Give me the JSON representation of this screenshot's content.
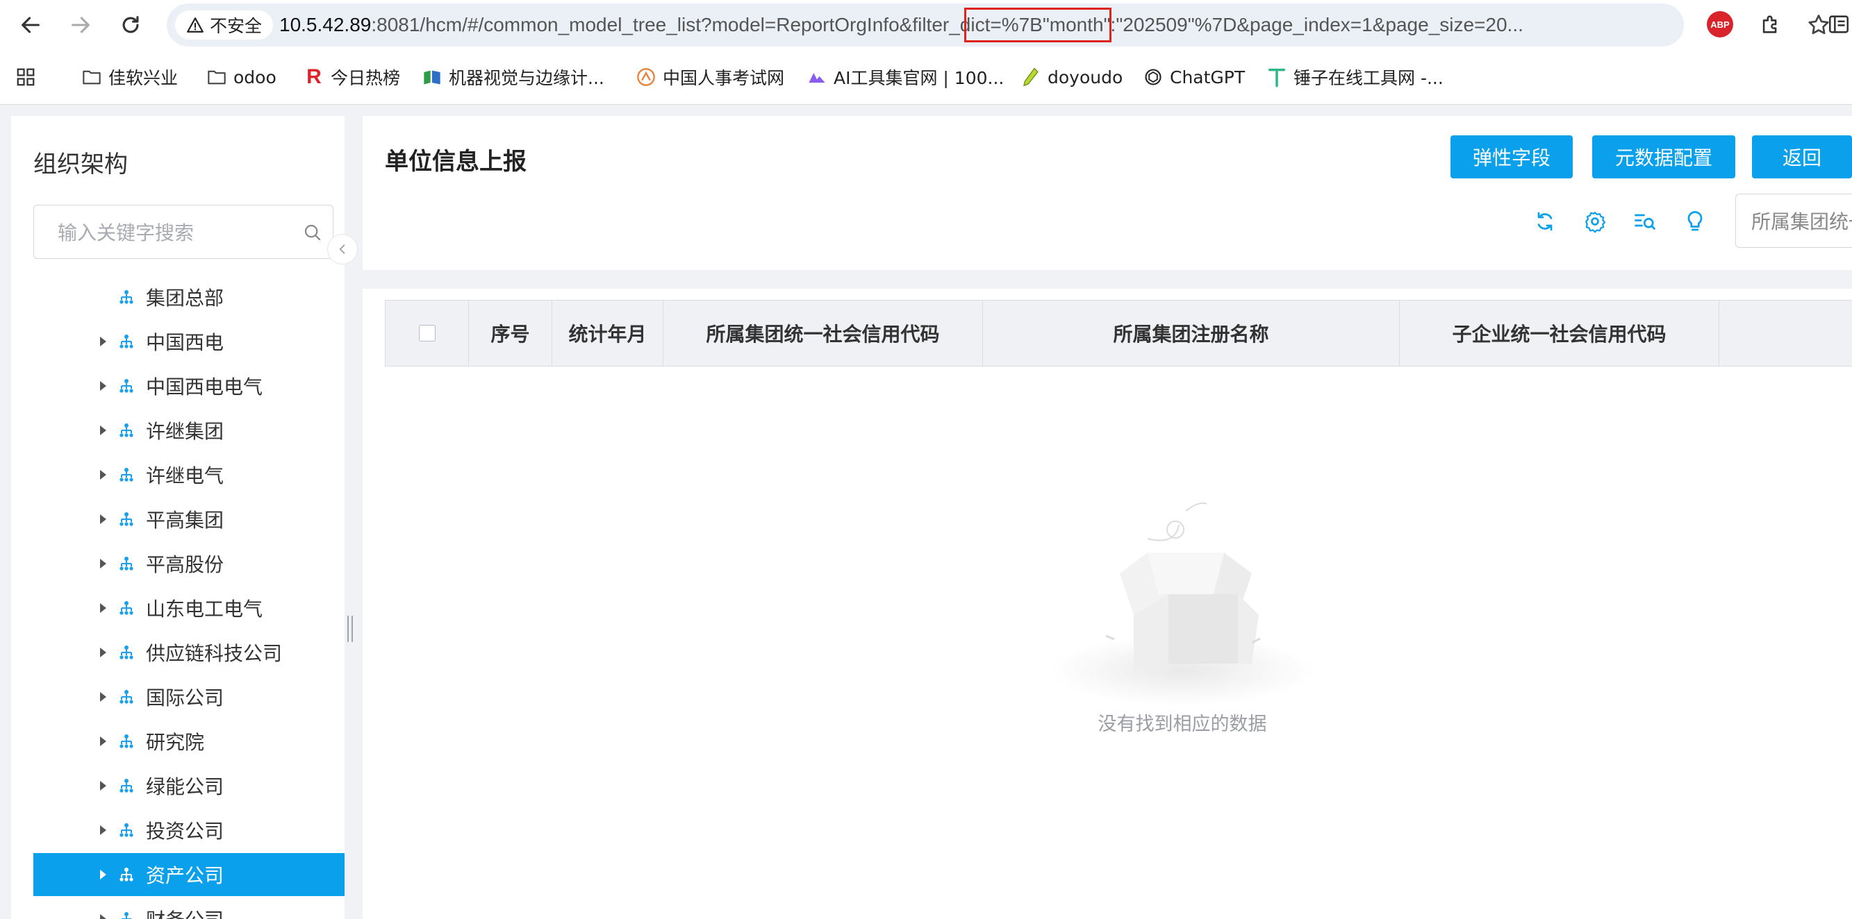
{
  "browser": {
    "security_label": "不安全",
    "url_host": "10.5.42.89",
    "url_rest": ":8081/hcm/#/common_model_tree_list?model=ReportOrgInfo&filter_dict=%7B\"month\":\"202509\"%7D&page_index=1&page_size=20...",
    "extension_badge": "ABP",
    "bookmarks": [
      {
        "label": "佳软兴业",
        "icon": "folder-icon"
      },
      {
        "label": "odoo",
        "icon": "folder-icon"
      },
      {
        "label": "今日热榜",
        "icon": "r-logo-icon"
      },
      {
        "label": "机器视觉与边缘计...",
        "icon": "book-icon"
      },
      {
        "label": "中国人事考试网",
        "icon": "exam-logo-icon"
      },
      {
        "label": "AI工具集官网 | 100...",
        "icon": "ai-logo-icon"
      },
      {
        "label": "doyoudo",
        "icon": "pencil-logo-icon"
      },
      {
        "label": "ChatGPT",
        "icon": "chatgpt-icon"
      },
      {
        "label": "锤子在线工具网 -...",
        "icon": "hammer-logo-icon"
      }
    ]
  },
  "sidebar": {
    "title": "组织架构",
    "search_placeholder": "输入关键字搜索",
    "nodes": [
      {
        "label": "集团总部",
        "has_children": false,
        "active": false
      },
      {
        "label": "中国西电",
        "has_children": true,
        "active": false
      },
      {
        "label": "中国西电电气",
        "has_children": true,
        "active": false
      },
      {
        "label": "许继集团",
        "has_children": true,
        "active": false
      },
      {
        "label": "许继电气",
        "has_children": true,
        "active": false
      },
      {
        "label": "平高集团",
        "has_children": true,
        "active": false
      },
      {
        "label": "平高股份",
        "has_children": true,
        "active": false
      },
      {
        "label": "山东电工电气",
        "has_children": true,
        "active": false
      },
      {
        "label": "供应链科技公司",
        "has_children": true,
        "active": false
      },
      {
        "label": "国际公司",
        "has_children": true,
        "active": false
      },
      {
        "label": "研究院",
        "has_children": true,
        "active": false
      },
      {
        "label": "绿能公司",
        "has_children": true,
        "active": false
      },
      {
        "label": "投资公司",
        "has_children": true,
        "active": false
      },
      {
        "label": "资产公司",
        "has_children": true,
        "active": true
      },
      {
        "label": "财务公司",
        "has_children": true,
        "active": false
      }
    ]
  },
  "header": {
    "title": "单位信息上报",
    "buttons": [
      "弹性字段",
      "元数据配置",
      "返回"
    ],
    "tools": [
      "refresh-icon",
      "settings-icon",
      "search-detail-icon",
      "bulb-icon"
    ],
    "filter_placeholder": "所属集团统一社会信用代码"
  },
  "table": {
    "columns": [
      "序号",
      "统计年月",
      "所属集团统一社会信用代码",
      "所属集团注册名称",
      "子企业统一社会信用代码"
    ],
    "empty_text": "没有找到相应的数据"
  },
  "colors": {
    "accent": "#0aa0eb",
    "highlight_box": "#e0231b"
  }
}
